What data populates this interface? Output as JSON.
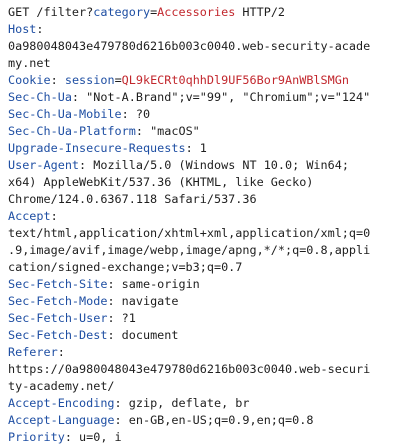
{
  "request": {
    "line1": {
      "method_path": "GET /filter?",
      "param_name": "category",
      "equals": "=",
      "param_value": "Accessories",
      "protocol": " HTTP/2"
    },
    "headers": [
      {
        "name": "Host",
        "value_lines": [
          "0a980048043e479780d6216b003c0040.web-security-acade",
          "my.net"
        ]
      },
      {
        "name": "Cookie",
        "cookie_name": "session",
        "cookie_value": "QL9kECRt0qhhDl9UF56Bor9AnWBlSMGn"
      },
      {
        "name": "Sec-Ch-Ua",
        "value_inline": "\"Not-A.Brand\";v=\"99\", \"Chromium\";v=\"124\""
      },
      {
        "name": "Sec-Ch-Ua-Mobile",
        "value_inline": "?0"
      },
      {
        "name": "Sec-Ch-Ua-Platform",
        "value_inline": "\"macOS\""
      },
      {
        "name": "Upgrade-Insecure-Requests",
        "value_inline": "1"
      },
      {
        "name": "User-Agent",
        "value_inline": "Mozilla/5.0 (Windows NT 10.0; Win64;",
        "value_lines": [
          "x64) AppleWebKit/537.36 (KHTML, like Gecko)",
          "Chrome/124.0.6367.118 Safari/537.36"
        ]
      },
      {
        "name": "Accept",
        "value_lines": [
          "text/html,application/xhtml+xml,application/xml;q=0",
          ".9,image/avif,image/webp,image/apng,*/*;q=0.8,appli",
          "cation/signed-exchange;v=b3;q=0.7"
        ]
      },
      {
        "name": "Sec-Fetch-Site",
        "value_inline": "same-origin"
      },
      {
        "name": "Sec-Fetch-Mode",
        "value_inline": "navigate"
      },
      {
        "name": "Sec-Fetch-User",
        "value_inline": "?1"
      },
      {
        "name": "Sec-Fetch-Dest",
        "value_inline": "document"
      },
      {
        "name": "Referer",
        "value_lines": [
          "https://0a980048043e479780d6216b003c0040.web-securi",
          "ty-academy.net/"
        ]
      },
      {
        "name": "Accept-Encoding",
        "value_inline": "gzip, deflate, br"
      },
      {
        "name": "Accept-Language",
        "value_inline": "en-GB,en-US;q=0.9,en;q=0.8"
      },
      {
        "name": "Priority",
        "value_inline": "u=0, i"
      }
    ]
  }
}
